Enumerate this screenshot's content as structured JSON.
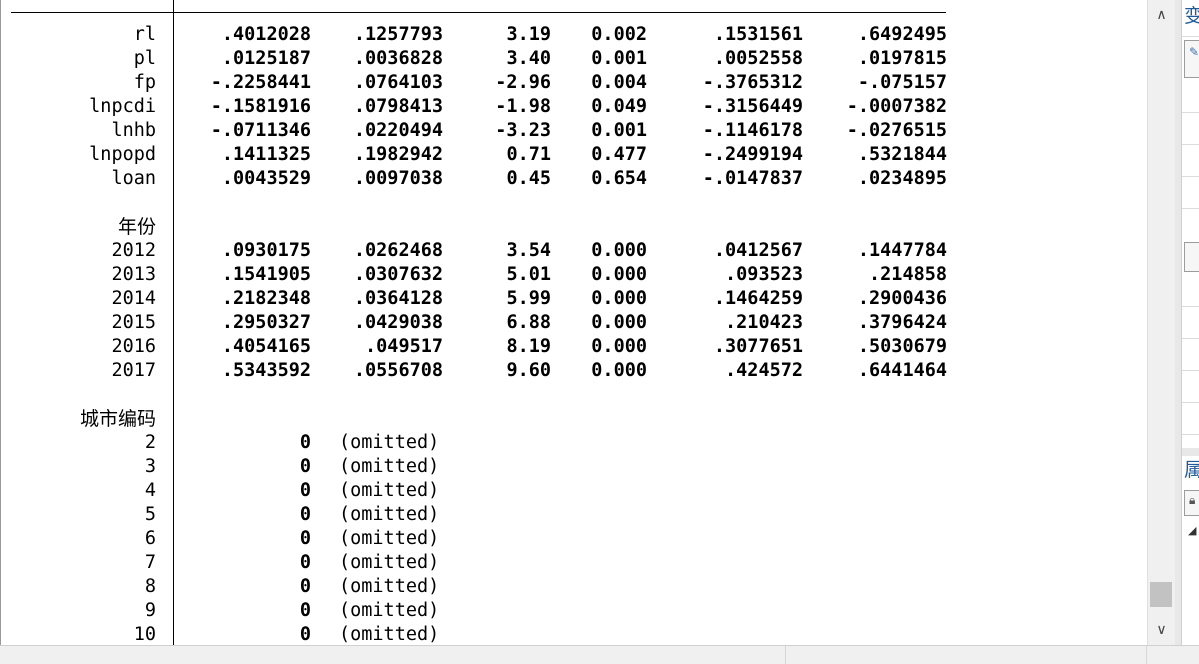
{
  "coef_rows": [
    {
      "name": "rl",
      "coef": ".4012028",
      "se": ".1257793",
      "t": "3.19",
      "p": "0.002",
      "lo": ".1531561",
      "hi": ".6492495"
    },
    {
      "name": "pl",
      "coef": ".0125187",
      "se": ".0036828",
      "t": "3.40",
      "p": "0.001",
      "lo": ".0052558",
      "hi": ".0197815"
    },
    {
      "name": "fp",
      "coef": "-.2258441",
      "se": ".0764103",
      "t": "-2.96",
      "p": "0.004",
      "lo": "-.3765312",
      "hi": "-.075157"
    },
    {
      "name": "lnpcdi",
      "coef": "-.1581916",
      "se": ".0798413",
      "t": "-1.98",
      "p": "0.049",
      "lo": "-.3156449",
      "hi": "-.0007382"
    },
    {
      "name": "lnhb",
      "coef": "-.0711346",
      "se": ".0220494",
      "t": "-3.23",
      "p": "0.001",
      "lo": "-.1146178",
      "hi": "-.0276515"
    },
    {
      "name": "lnpopd",
      "coef": ".1411325",
      "se": ".1982942",
      "t": "0.71",
      "p": "0.477",
      "lo": "-.2499194",
      "hi": ".5321844"
    },
    {
      "name": "loan",
      "coef": ".0043529",
      "se": ".0097038",
      "t": "0.45",
      "p": "0.654",
      "lo": "-.0147837",
      "hi": ".0234895"
    }
  ],
  "year_header": "年份",
  "year_rows": [
    {
      "name": "2012",
      "coef": ".0930175",
      "se": ".0262468",
      "t": "3.54",
      "p": "0.000",
      "lo": ".0412567",
      "hi": ".1447784"
    },
    {
      "name": "2013",
      "coef": ".1541905",
      "se": ".0307632",
      "t": "5.01",
      "p": "0.000",
      "lo": ".093523",
      "hi": ".214858"
    },
    {
      "name": "2014",
      "coef": ".2182348",
      "se": ".0364128",
      "t": "5.99",
      "p": "0.000",
      "lo": ".1464259",
      "hi": ".2900436"
    },
    {
      "name": "2015",
      "coef": ".2950327",
      "se": ".0429038",
      "t": "6.88",
      "p": "0.000",
      "lo": ".210423",
      "hi": ".3796424"
    },
    {
      "name": "2016",
      "coef": ".4054165",
      "se": ".049517",
      "t": "8.19",
      "p": "0.000",
      "lo": ".3077651",
      "hi": ".5030679"
    },
    {
      "name": "2017",
      "coef": ".5343592",
      "se": ".0556708",
      "t": "9.60",
      "p": "0.000",
      "lo": ".424572",
      "hi": ".6441464"
    }
  ],
  "city_header": "城市编码",
  "city_rows": [
    {
      "name": "2",
      "coef": "0",
      "note": "(omitted)"
    },
    {
      "name": "3",
      "coef": "0",
      "note": "(omitted)"
    },
    {
      "name": "4",
      "coef": "0",
      "note": "(omitted)"
    },
    {
      "name": "5",
      "coef": "0",
      "note": "(omitted)"
    },
    {
      "name": "6",
      "coef": "0",
      "note": "(omitted)"
    },
    {
      "name": "7",
      "coef": "0",
      "note": "(omitted)"
    },
    {
      "name": "8",
      "coef": "0",
      "note": "(omitted)"
    },
    {
      "name": "9",
      "coef": "0",
      "note": "(omitted)"
    },
    {
      "name": "10",
      "coef": "0",
      "note": "(omitted)"
    }
  ],
  "right_panel": {
    "title_top": "变",
    "title_mid": "属"
  },
  "icons": {
    "scroll_up": "chevron-up-icon",
    "scroll_down": "chevron-down-icon",
    "lock": "lock-icon",
    "expand": "triangle-icon"
  }
}
